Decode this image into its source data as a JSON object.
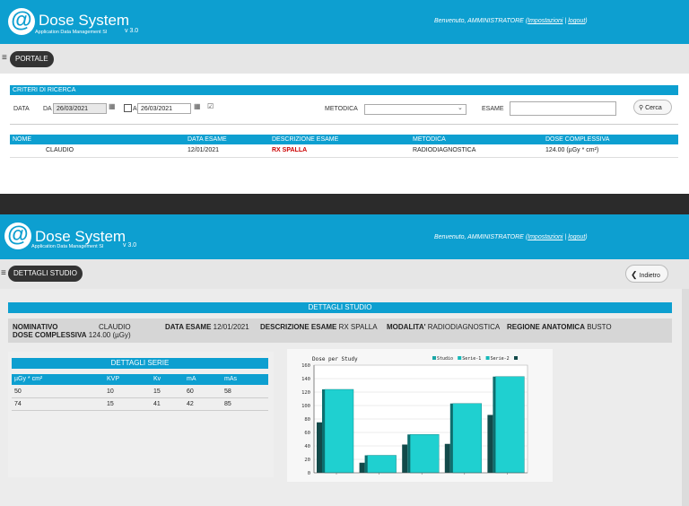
{
  "app": {
    "logo_glyph": "@",
    "title": "Dose System",
    "subtitle": "Application Data Management Sl",
    "version": "v 3.0"
  },
  "header": {
    "welcome": "Benvenuto, AMMINISTRATORE",
    "settings_link": "Impostazioni",
    "logout_link": "logout",
    "sep_open": "(",
    "sep_mid": "|",
    "sep_close": ")"
  },
  "search_page": {
    "nav_pill": "PORTALE",
    "criteria_title": "CRITERI DI RICERCA",
    "data_label": "DATA",
    "da_label": "DA",
    "date_from": "26/03/2021",
    "a_label": "A",
    "date_to": "26/03/2021",
    "metodica_label": "METODICA",
    "metodica_value": "",
    "esame_label": "ESAME",
    "esame_value": "",
    "search_button": "Cerca",
    "columns": [
      "NOME",
      "DATA ESAME",
      "DESCRIZIONE ESAME",
      "METODICA",
      "DOSE COMPLESSIVA"
    ],
    "rows": [
      {
        "nome": "CLAUDIO",
        "data_esame": "12/01/2021",
        "descrizione": "RX SPALLA",
        "metodica": "RADIODIAGNOSTICA",
        "dose": "124.00 (µGy * cm²)"
      }
    ]
  },
  "detail_page": {
    "nav_pill": "DETTAGLI STUDIO",
    "back_button": "Indietro",
    "section_title": "DETTAGLI STUDIO",
    "fields": {
      "nominativo_label": "NOMINATIVO",
      "nominativo_value": "CLAUDIO",
      "data_esame_label": "DATA ESAME",
      "data_esame_value": "12/01/2021",
      "descrizione_label": "DESCRIZIONE ESAME",
      "descrizione_value": "RX SPALLA",
      "modalita_label": "MODALITA'",
      "modalita_value": "RADIODIAGNOSTICA",
      "regione_label": "REGIONE ANATOMICA",
      "regione_value": "BUSTO",
      "dose_label": "DOSE COMPLESSIVA",
      "dose_value": "124.00 (µGy)"
    },
    "series_title": "DETTAGLI SERIE",
    "series_columns": [
      "µGy * cm²",
      "KVP",
      "Kv",
      "mA",
      "mAs"
    ],
    "series_rows": [
      [
        "50",
        "10",
        "15",
        "60",
        "58"
      ],
      [
        "74",
        "15",
        "41",
        "42",
        "85"
      ]
    ]
  },
  "colors": {
    "header": "#0d9fd0",
    "bar_teal": "#1fd0d0",
    "bar_dark": "#124a4a"
  },
  "chart_data": {
    "type": "bar",
    "title": "Dose per Study",
    "series": [
      {
        "name": "Studio",
        "values": [
          75,
          15,
          42,
          43,
          86
        ]
      },
      {
        "name": "Serie-1",
        "values": [
          124,
          26,
          57,
          103,
          143
        ]
      },
      {
        "name": "Serie-2",
        "values": []
      },
      {
        "name": "",
        "values": []
      }
    ],
    "categories": [
      "",
      "",
      "",
      "",
      ""
    ],
    "ylim": [
      0,
      160
    ],
    "yticks": [
      "0",
      "20",
      "40",
      "60",
      "80",
      "100",
      "120",
      "140",
      "160"
    ],
    "grid": true,
    "legend": "top-right"
  }
}
